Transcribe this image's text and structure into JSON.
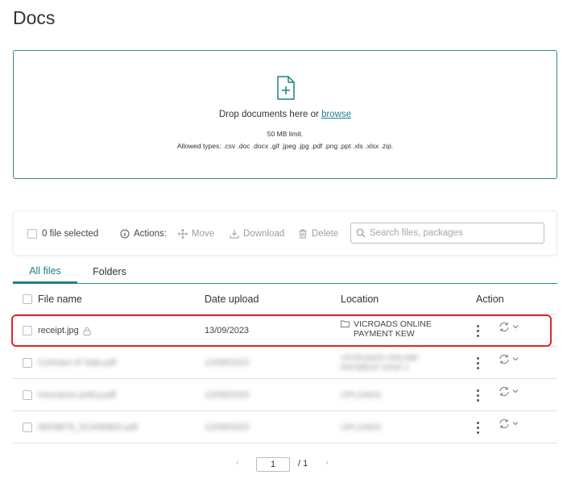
{
  "page": {
    "title": "Docs"
  },
  "dropzone": {
    "text": "Drop documents here or ",
    "browse_link": "browse",
    "limit": "50 MB limit.",
    "allowed_types": "Allowed types: .csv .doc .docx .gif .jpeg .jpg .pdf .png .ppt .xls .xlsx .zip."
  },
  "toolbar": {
    "selected": "0 file selected",
    "actions_label": "Actions:",
    "move": "Move",
    "download": "Download",
    "delete": "Delete",
    "search_placeholder": "Search files, packages"
  },
  "tabs": [
    {
      "label": "All files",
      "active": true
    },
    {
      "label": "Folders",
      "active": false
    }
  ],
  "table": {
    "columns": [
      "File name",
      "Date upload",
      "Location",
      "Action"
    ],
    "rows": [
      {
        "name": "receipt.jpg",
        "date": "13/09/2023",
        "location": [
          "VICROADS ONLINE",
          "PAYMENT KEW"
        ],
        "locked": true,
        "blurred": false
      },
      {
        "name": "Contract of Sale.pdf",
        "date": "12/09/2023",
        "location": [
          "VICROADS ONLINE",
          "PAYMENT KEW 2"
        ],
        "locked": true,
        "blurred": true
      },
      {
        "name": "Insurance policy.pdf",
        "date": "12/09/2023",
        "location": [
          "Uploads"
        ],
        "locked": true,
        "blurred": true
      },
      {
        "name": "IMG8876_SCANNED.pdf",
        "date": "12/09/2023",
        "location": [
          "Uploads"
        ],
        "locked": true,
        "blurred": true
      }
    ]
  },
  "pagination": {
    "current": "1",
    "total": "/ 1"
  },
  "colors": {
    "accent": "#1f7f8a",
    "border": "#2e8c86",
    "highlight": "#e0262b"
  },
  "icons": [
    "file-add-icon",
    "info-icon",
    "move-icon",
    "download-icon",
    "trash-icon",
    "search-icon",
    "lock-icon",
    "folder-icon",
    "sync-icon",
    "chevron-down-icon",
    "kebab-menu-icon"
  ]
}
